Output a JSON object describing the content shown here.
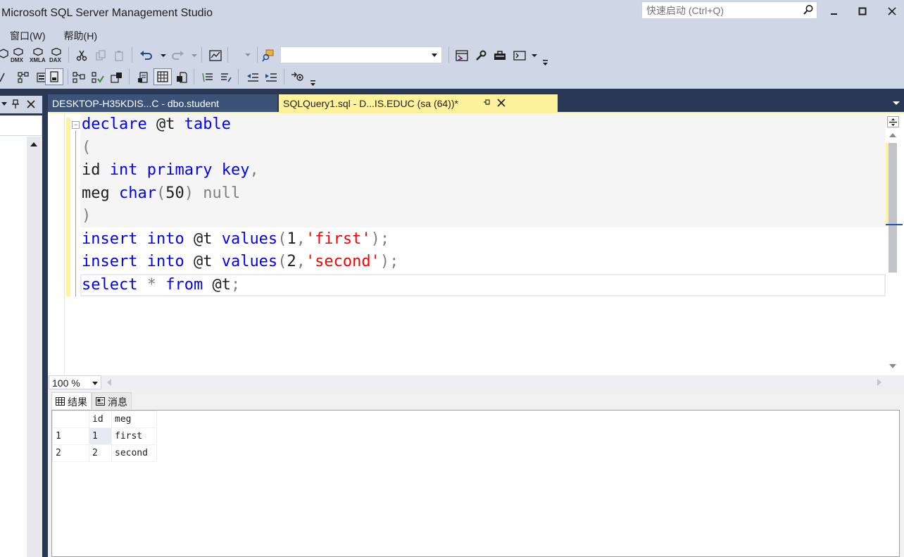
{
  "app": {
    "title": "Microsoft SQL Server Management Studio",
    "quick_launch_placeholder": "快速启动 (Ctrl+Q)"
  },
  "menu": {
    "items": [
      "窗口(W)",
      "帮助(H)"
    ]
  },
  "toolbar": {
    "row1_icons": [
      "mdx-query-icon",
      "dmx-query-icon",
      "xmla-query-icon",
      "dax-query-icon",
      "cut-icon",
      "copy-icon",
      "paste-icon",
      "undo-icon",
      "redo-icon",
      "activity-monitor-icon",
      "find-icon",
      "object-explorer-icon",
      "properties-icon",
      "toolbox-icon",
      "command-window-icon"
    ],
    "row1_labels": [
      "DMX",
      "XMLA",
      "DAX"
    ],
    "database_value": "",
    "row2_icons": [
      "change-connection-icon",
      "display-estimated-plan-icon",
      "query-options-icon",
      "results-to-text-icon",
      "results-to-grid-icon",
      "results-to-file-icon",
      "comment-icon",
      "uncomment-icon",
      "decrease-indent-icon",
      "increase-indent-icon",
      "specify-values-icon"
    ]
  },
  "tabs": {
    "inactive_label": "DESKTOP-H35KDIS...C - dbo.student",
    "active_label": "SQLQuery1.sql - D...IS.EDUC (sa (64))*"
  },
  "editor": {
    "lines": [
      [
        {
          "t": "declare",
          "c": "kw"
        },
        {
          "t": " @t "
        },
        {
          "t": "table",
          "c": "kw"
        }
      ],
      [
        {
          "t": "(",
          "c": "gray"
        }
      ],
      [
        {
          "t": "id "
        },
        {
          "t": "int",
          "c": "kw"
        },
        {
          "t": " "
        },
        {
          "t": "primary",
          "c": "kw"
        },
        {
          "t": " "
        },
        {
          "t": "key",
          "c": "kw"
        },
        {
          "t": ",",
          "c": "gray"
        }
      ],
      [
        {
          "t": "meg "
        },
        {
          "t": "char",
          "c": "kw"
        },
        {
          "t": "(",
          "c": "gray"
        },
        {
          "t": "50"
        },
        {
          "t": ")",
          "c": "gray"
        },
        {
          "t": " "
        },
        {
          "t": "null",
          "c": "gray"
        }
      ],
      [
        {
          "t": ")",
          "c": "gray"
        }
      ],
      [
        {
          "t": "insert",
          "c": "kw"
        },
        {
          "t": " "
        },
        {
          "t": "into",
          "c": "kw"
        },
        {
          "t": " @t "
        },
        {
          "t": "values",
          "c": "kw"
        },
        {
          "t": "(",
          "c": "gray"
        },
        {
          "t": "1"
        },
        {
          "t": ",",
          "c": "gray"
        },
        {
          "t": "'first'",
          "c": "str"
        },
        {
          "t": ");",
          "c": "gray"
        }
      ],
      [
        {
          "t": "insert",
          "c": "kw"
        },
        {
          "t": " "
        },
        {
          "t": "into",
          "c": "kw"
        },
        {
          "t": " @t "
        },
        {
          "t": "values",
          "c": "kw"
        },
        {
          "t": "(",
          "c": "gray"
        },
        {
          "t": "2"
        },
        {
          "t": ",",
          "c": "gray"
        },
        {
          "t": "'second'",
          "c": "str"
        },
        {
          "t": ");",
          "c": "gray"
        }
      ],
      [
        {
          "t": "select",
          "c": "kw"
        },
        {
          "t": " "
        },
        {
          "t": "*",
          "c": "gray"
        },
        {
          "t": " "
        },
        {
          "t": "from",
          "c": "kw"
        },
        {
          "t": " @t"
        },
        {
          "t": ";",
          "c": "gray"
        }
      ]
    ]
  },
  "zoom": {
    "value": "100 %"
  },
  "results": {
    "tabs": [
      "结果",
      "消息"
    ],
    "columns": [
      "id",
      "meg"
    ],
    "rows": [
      {
        "num": "1",
        "id": "1",
        "meg": "first"
      },
      {
        "num": "2",
        "id": "2",
        "meg": "second"
      }
    ]
  },
  "colors": {
    "active_tab": "#fff29d",
    "workspace": "#293955",
    "chrome": "#cfd6e5",
    "keyword": "#0000ff",
    "string": "#ff0000",
    "operator": "#808080"
  }
}
